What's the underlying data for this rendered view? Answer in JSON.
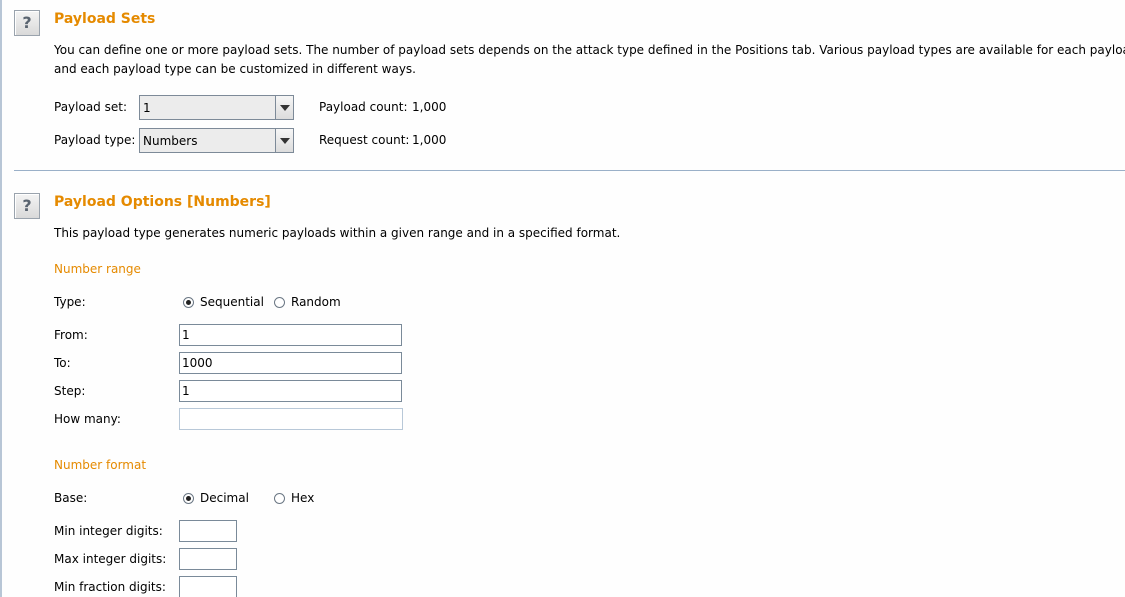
{
  "payload_sets": {
    "title": "Payload Sets",
    "description_line1": "You can define one or more payload sets. The number of payload sets depends on the attack type defined in the Positions tab. Various payload types are available for each payload set,",
    "description_line2": "and each payload type can be customized in different ways.",
    "payload_set_label": "Payload set:",
    "payload_set_value": "1",
    "payload_type_label": "Payload type:",
    "payload_type_value": "Numbers",
    "payload_count_label": "Payload count:",
    "payload_count_value": "1,000",
    "request_count_label": "Request count:",
    "request_count_value": "1,000"
  },
  "payload_options": {
    "title": "Payload Options [Numbers]",
    "description": "This payload type generates numeric payloads within a given range and in a specified format.",
    "number_range": {
      "heading": "Number range",
      "type_label": "Type:",
      "type_options": [
        {
          "label": "Sequential",
          "checked": true
        },
        {
          "label": "Random",
          "checked": false
        }
      ],
      "from_label": "From:",
      "from_value": "1",
      "to_label": "To:",
      "to_value": "1000",
      "step_label": "Step:",
      "step_value": "1",
      "how_many_label": "How many:",
      "how_many_value": ""
    },
    "number_format": {
      "heading": "Number format",
      "base_label": "Base:",
      "base_options": [
        {
          "label": "Decimal",
          "checked": true
        },
        {
          "label": "Hex",
          "checked": false
        }
      ],
      "min_integer_label": "Min integer digits:",
      "min_integer_value": "",
      "max_integer_label": "Max integer digits:",
      "max_integer_value": "",
      "min_fraction_label": "Min fraction digits:",
      "min_fraction_value": ""
    }
  },
  "icons": {
    "help": "?"
  }
}
